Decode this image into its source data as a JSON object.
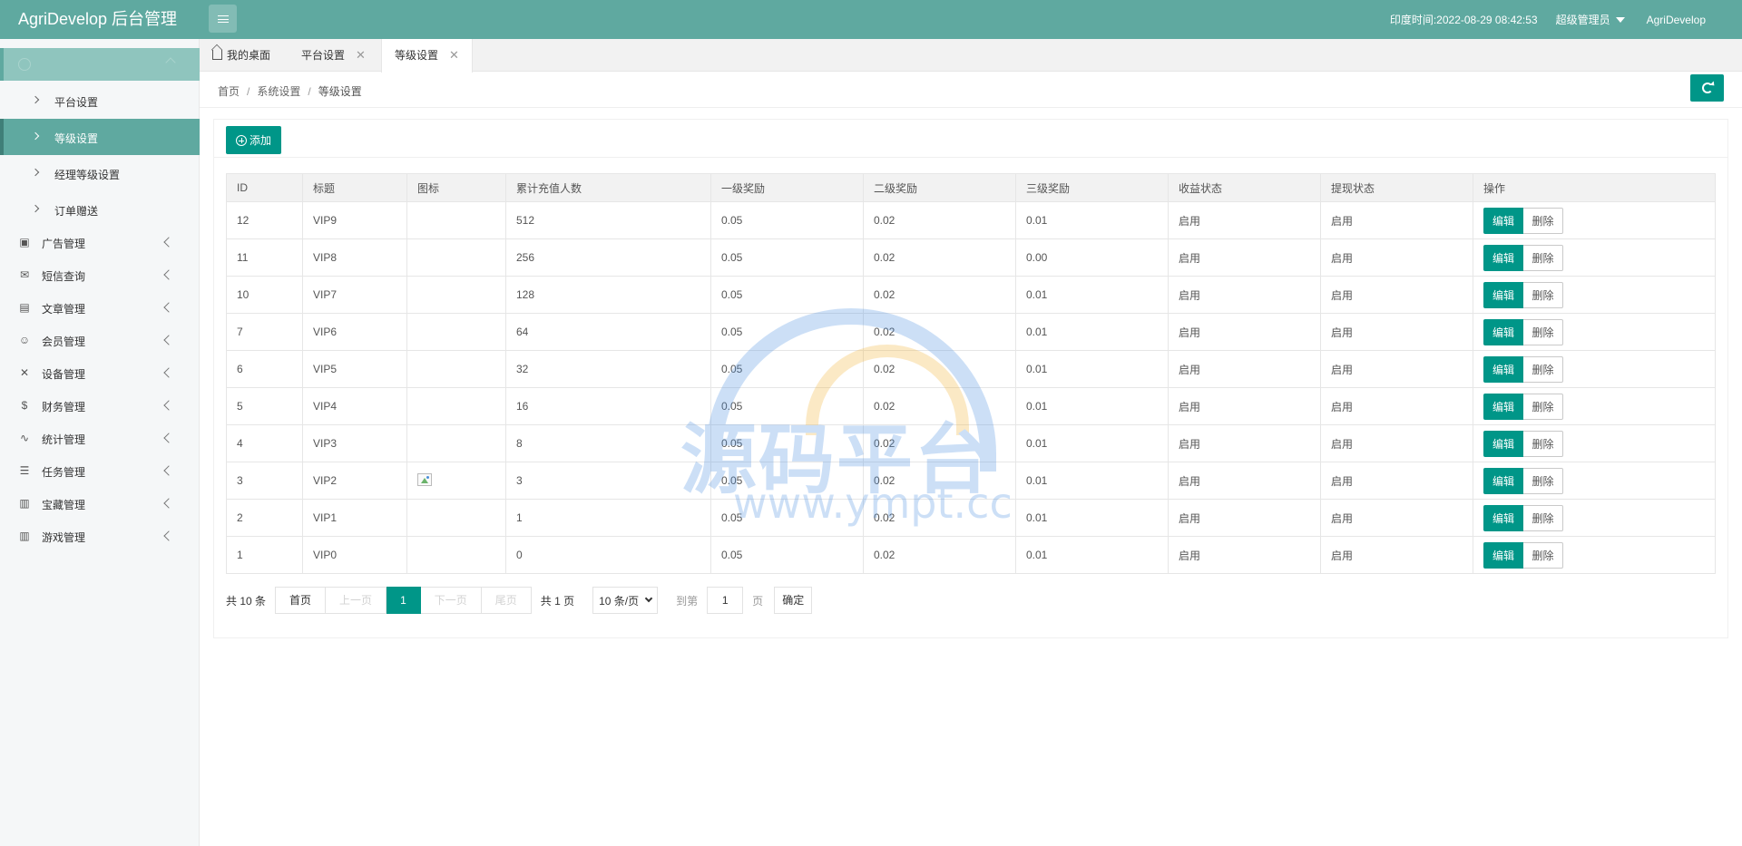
{
  "header": {
    "brand": "AgriDevelop 后台管理",
    "time_label": "印度时间:",
    "time_value": "2022-08-29 08:42:53",
    "role": "超级管理员",
    "user": "AgriDevelop"
  },
  "sidebar": {
    "sub_items": [
      {
        "label": "平台设置"
      },
      {
        "label": "等级设置"
      },
      {
        "label": "经理等级设置"
      },
      {
        "label": "订单赠送"
      }
    ],
    "menu": [
      {
        "label": "广告管理",
        "icon": "image-icon"
      },
      {
        "label": "短信查询",
        "icon": "mail-icon"
      },
      {
        "label": "文章管理",
        "icon": "book-icon"
      },
      {
        "label": "会员管理",
        "icon": "user-icon"
      },
      {
        "label": "设备管理",
        "icon": "tools-icon"
      },
      {
        "label": "财务管理",
        "icon": "dollar-icon"
      },
      {
        "label": "统计管理",
        "icon": "pulse-icon"
      },
      {
        "label": "任务管理",
        "icon": "sliders-icon"
      },
      {
        "label": "宝藏管理",
        "icon": "gift-icon"
      },
      {
        "label": "游戏管理",
        "icon": "gift-icon"
      }
    ]
  },
  "tabs": [
    {
      "label": "我的桌面"
    },
    {
      "label": "平台设置"
    },
    {
      "label": "等级设置"
    }
  ],
  "breadcrumb": {
    "home": "首页",
    "section": "系统设置",
    "current": "等级设置"
  },
  "toolbar": {
    "add_label": "添加"
  },
  "table": {
    "headers": [
      "ID",
      "标题",
      "图标",
      "累计充值人数",
      "一级奖励",
      "二级奖励",
      "三级奖励",
      "收益状态",
      "提现状态",
      "操作"
    ],
    "edit_label": "编辑",
    "delete_label": "删除",
    "rows": [
      {
        "id": "12",
        "title": "VIP9",
        "icon": "",
        "count": "512",
        "l1": "0.05",
        "l2": "0.02",
        "l3": "0.01",
        "income": "启用",
        "withdraw": "启用"
      },
      {
        "id": "11",
        "title": "VIP8",
        "icon": "",
        "count": "256",
        "l1": "0.05",
        "l2": "0.02",
        "l3": "0.00",
        "income": "启用",
        "withdraw": "启用"
      },
      {
        "id": "10",
        "title": "VIP7",
        "icon": "",
        "count": "128",
        "l1": "0.05",
        "l2": "0.02",
        "l3": "0.01",
        "income": "启用",
        "withdraw": "启用"
      },
      {
        "id": "7",
        "title": "VIP6",
        "icon": "",
        "count": "64",
        "l1": "0.05",
        "l2": "0.02",
        "l3": "0.01",
        "income": "启用",
        "withdraw": "启用"
      },
      {
        "id": "6",
        "title": "VIP5",
        "icon": "",
        "count": "32",
        "l1": "0.05",
        "l2": "0.02",
        "l3": "0.01",
        "income": "启用",
        "withdraw": "启用"
      },
      {
        "id": "5",
        "title": "VIP4",
        "icon": "",
        "count": "16",
        "l1": "0.05",
        "l2": "0.02",
        "l3": "0.01",
        "income": "启用",
        "withdraw": "启用"
      },
      {
        "id": "4",
        "title": "VIP3",
        "icon": "",
        "count": "8",
        "l1": "0.05",
        "l2": "0.02",
        "l3": "0.01",
        "income": "启用",
        "withdraw": "启用"
      },
      {
        "id": "3",
        "title": "VIP2",
        "icon": "broken-image",
        "count": "3",
        "l1": "0.05",
        "l2": "0.02",
        "l3": "0.01",
        "income": "启用",
        "withdraw": "启用"
      },
      {
        "id": "2",
        "title": "VIP1",
        "icon": "",
        "count": "1",
        "l1": "0.05",
        "l2": "0.02",
        "l3": "0.01",
        "income": "启用",
        "withdraw": "启用"
      },
      {
        "id": "1",
        "title": "VIP0",
        "icon": "",
        "count": "0",
        "l1": "0.05",
        "l2": "0.02",
        "l3": "0.01",
        "income": "启用",
        "withdraw": "启用"
      }
    ]
  },
  "pager": {
    "count": "共 10 条",
    "first": "首页",
    "prev": "上一页",
    "current": "1",
    "next": "下一页",
    "last": "尾页",
    "total_pages": "共 1 页",
    "page_size": "10 条/页",
    "goto_label": "到第",
    "goto_value": "1",
    "page_label": "页",
    "confirm": "确定"
  },
  "watermark": {
    "text": "源码平台",
    "url": "www.ympt.cc"
  },
  "colors": {
    "header": "#5fa9a0",
    "primary": "#009688",
    "status": "#5fb878"
  }
}
